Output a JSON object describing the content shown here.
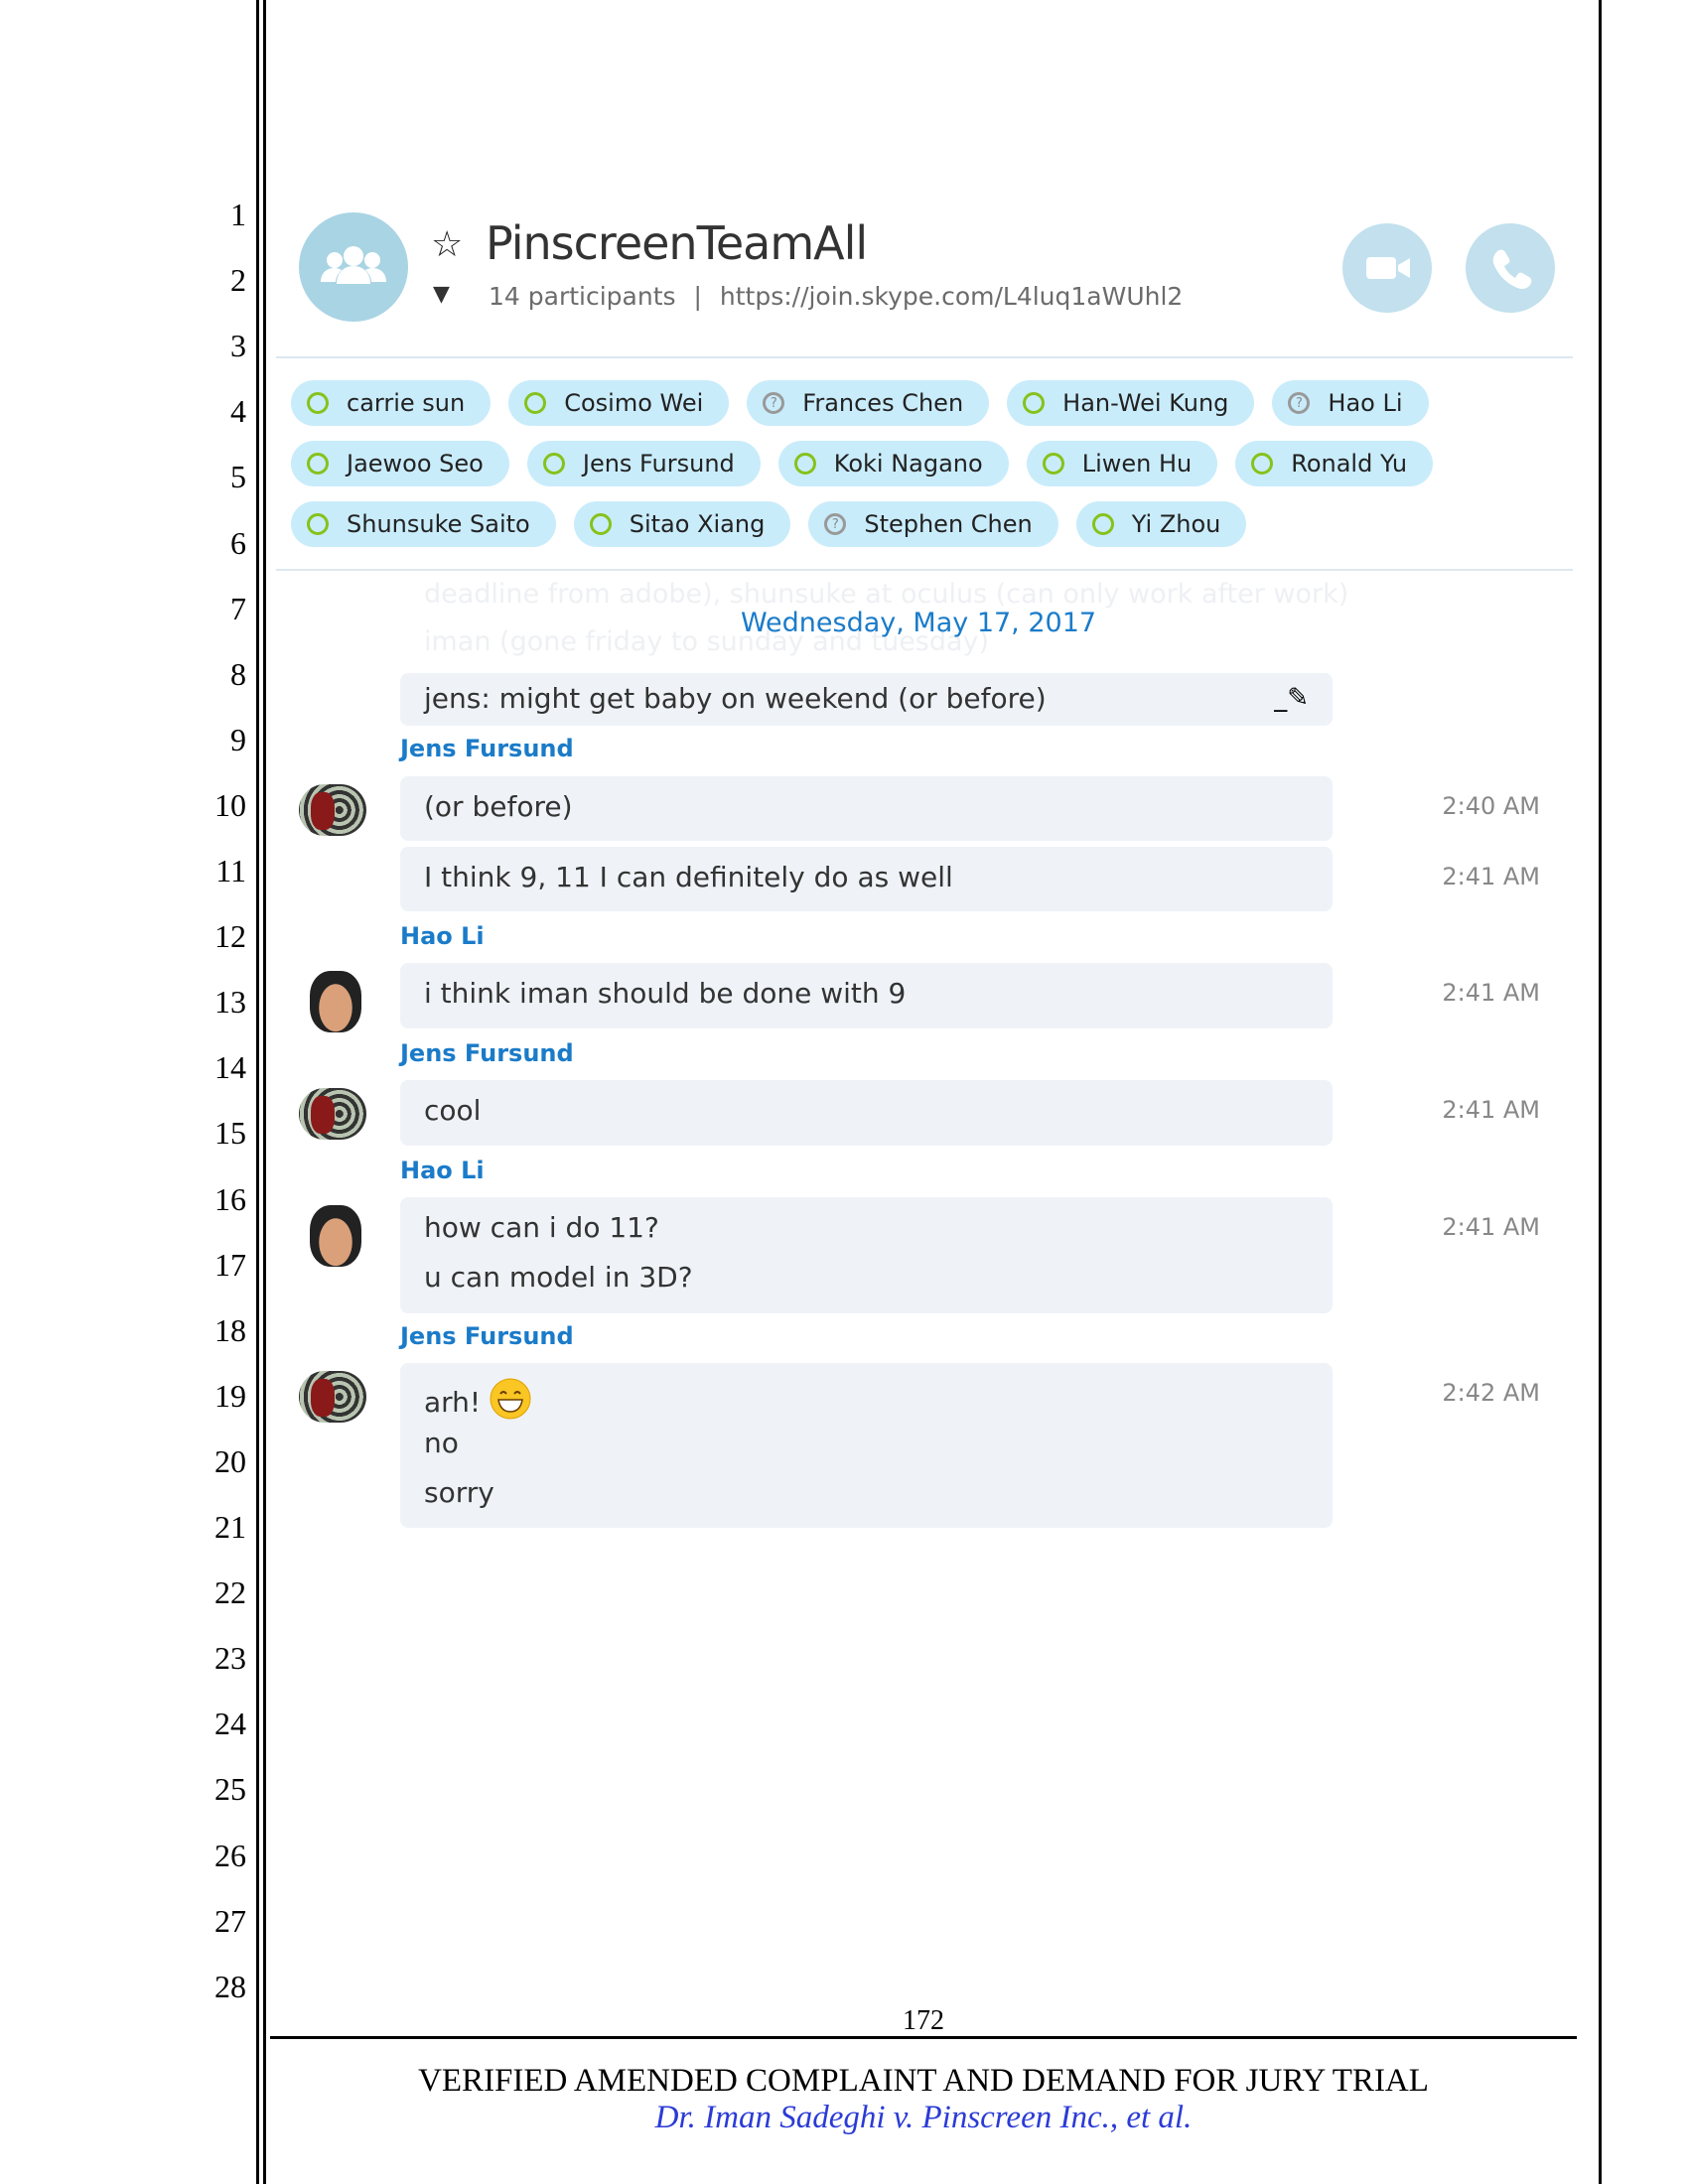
{
  "line_numbers": [
    "1",
    "2",
    "3",
    "4",
    "5",
    "6",
    "7",
    "8",
    "9",
    "10",
    "11",
    "12",
    "13",
    "14",
    "15",
    "16",
    "17",
    "18",
    "19",
    "20",
    "21",
    "22",
    "23",
    "24",
    "25",
    "26",
    "27",
    "28"
  ],
  "header": {
    "title": "PinscreenTeamAll",
    "participants": "14 participants",
    "separator": "|",
    "link": "https://join.skype.com/L4luq1aWUhl2",
    "icons": {
      "avatar": "group-icon",
      "favorite": "star-icon",
      "expand": "chevron-down-icon",
      "video": "video-camera-icon",
      "call": "phone-icon"
    }
  },
  "colors": {
    "accent": "#1a7bc9",
    "chip": "#c9ecfb",
    "online": "#86c21b",
    "bubble": "#eff3f8",
    "call_button": "#c2e0ed"
  },
  "participants": [
    [
      {
        "name": "carrie sun",
        "status": "online"
      },
      {
        "name": "Cosimo Wei",
        "status": "online"
      },
      {
        "name": "Frances Chen",
        "status": "unknown"
      },
      {
        "name": "Han-Wei Kung",
        "status": "online"
      },
      {
        "name": "Hao Li",
        "status": "unknown"
      }
    ],
    [
      {
        "name": "Jaewoo Seo",
        "status": "online"
      },
      {
        "name": "Jens Fursund",
        "status": "online"
      },
      {
        "name": "Koki Nagano",
        "status": "online"
      },
      {
        "name": "Liwen Hu",
        "status": "online"
      },
      {
        "name": "Ronald Yu",
        "status": "online"
      }
    ],
    [
      {
        "name": "Shunsuke Saito",
        "status": "online"
      },
      {
        "name": "Sitao Xiang",
        "status": "online"
      },
      {
        "name": "Stephen Chen",
        "status": "unknown"
      },
      {
        "name": "Yi Zhou",
        "status": "online"
      }
    ]
  ],
  "chat": {
    "faded_lines": [
      "deadline from adobe), shunsuke at oculus (can only work after work)",
      "iman (gone friday to sunday and tuesday)"
    ],
    "date": "Wednesday, May 17, 2017",
    "edited_message": "jens: might get baby on weekend (or before)",
    "groups": [
      {
        "sender": "Jens Fursund",
        "avatar": "jens",
        "bubbles": [
          {
            "lines": [
              "(or before)"
            ],
            "time": "2:40 AM"
          },
          {
            "lines": [
              "I think 9, 11 I can definitely do as well"
            ],
            "time": "2:41 AM"
          }
        ]
      },
      {
        "sender": "Hao Li",
        "avatar": "hao",
        "bubbles": [
          {
            "lines": [
              "i think iman should be done with 9"
            ],
            "time": "2:41 AM"
          }
        ]
      },
      {
        "sender": "Jens Fursund",
        "avatar": "jens",
        "bubbles": [
          {
            "lines": [
              "cool"
            ],
            "time": "2:41 AM"
          }
        ]
      },
      {
        "sender": "Hao Li",
        "avatar": "hao",
        "bubbles": [
          {
            "lines": [
              "how can i do 11?",
              "u can model in 3D?"
            ],
            "time": "2:41 AM"
          }
        ]
      },
      {
        "sender": "Jens Fursund",
        "avatar": "jens",
        "bubbles": [
          {
            "lines": [
              "arh!",
              "no",
              "sorry"
            ],
            "time": "2:42 AM",
            "emoji": "grinning-face"
          }
        ]
      }
    ]
  },
  "footer": {
    "page_number": "172",
    "title": "VERIFIED AMENDED COMPLAINT AND DEMAND FOR JURY TRIAL",
    "case": "Dr. Iman Sadeghi v. Pinscreen Inc., et al."
  }
}
